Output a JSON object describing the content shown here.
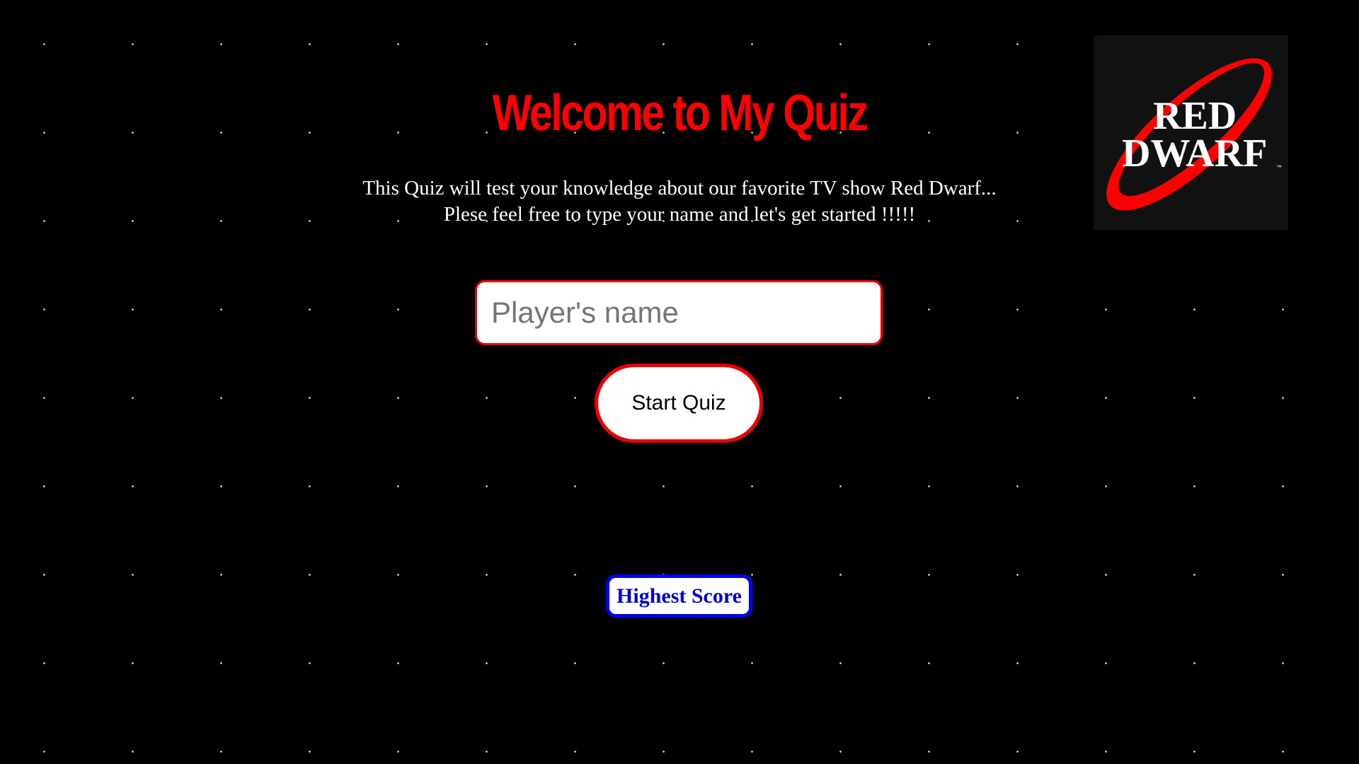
{
  "header": {
    "title": "Welcome to My Quiz"
  },
  "intro": {
    "line1": "This Quiz will test your knowledge about our favorite TV show Red Dwarf...",
    "line2": "Plese feel free to type your name and let's get started !!!!!"
  },
  "form": {
    "name_placeholder": "Player's name",
    "name_value": "",
    "start_label": "Start Quiz"
  },
  "score": {
    "link_label": "Highest Score"
  },
  "logo": {
    "word1": "RED",
    "word2": "DWARF",
    "trademark": "™",
    "icon": "red-dwarf-logo"
  },
  "colors": {
    "background": "#000000",
    "title": "#ff0000",
    "accent_red": "#ee0000",
    "link_blue": "#0000cc"
  }
}
